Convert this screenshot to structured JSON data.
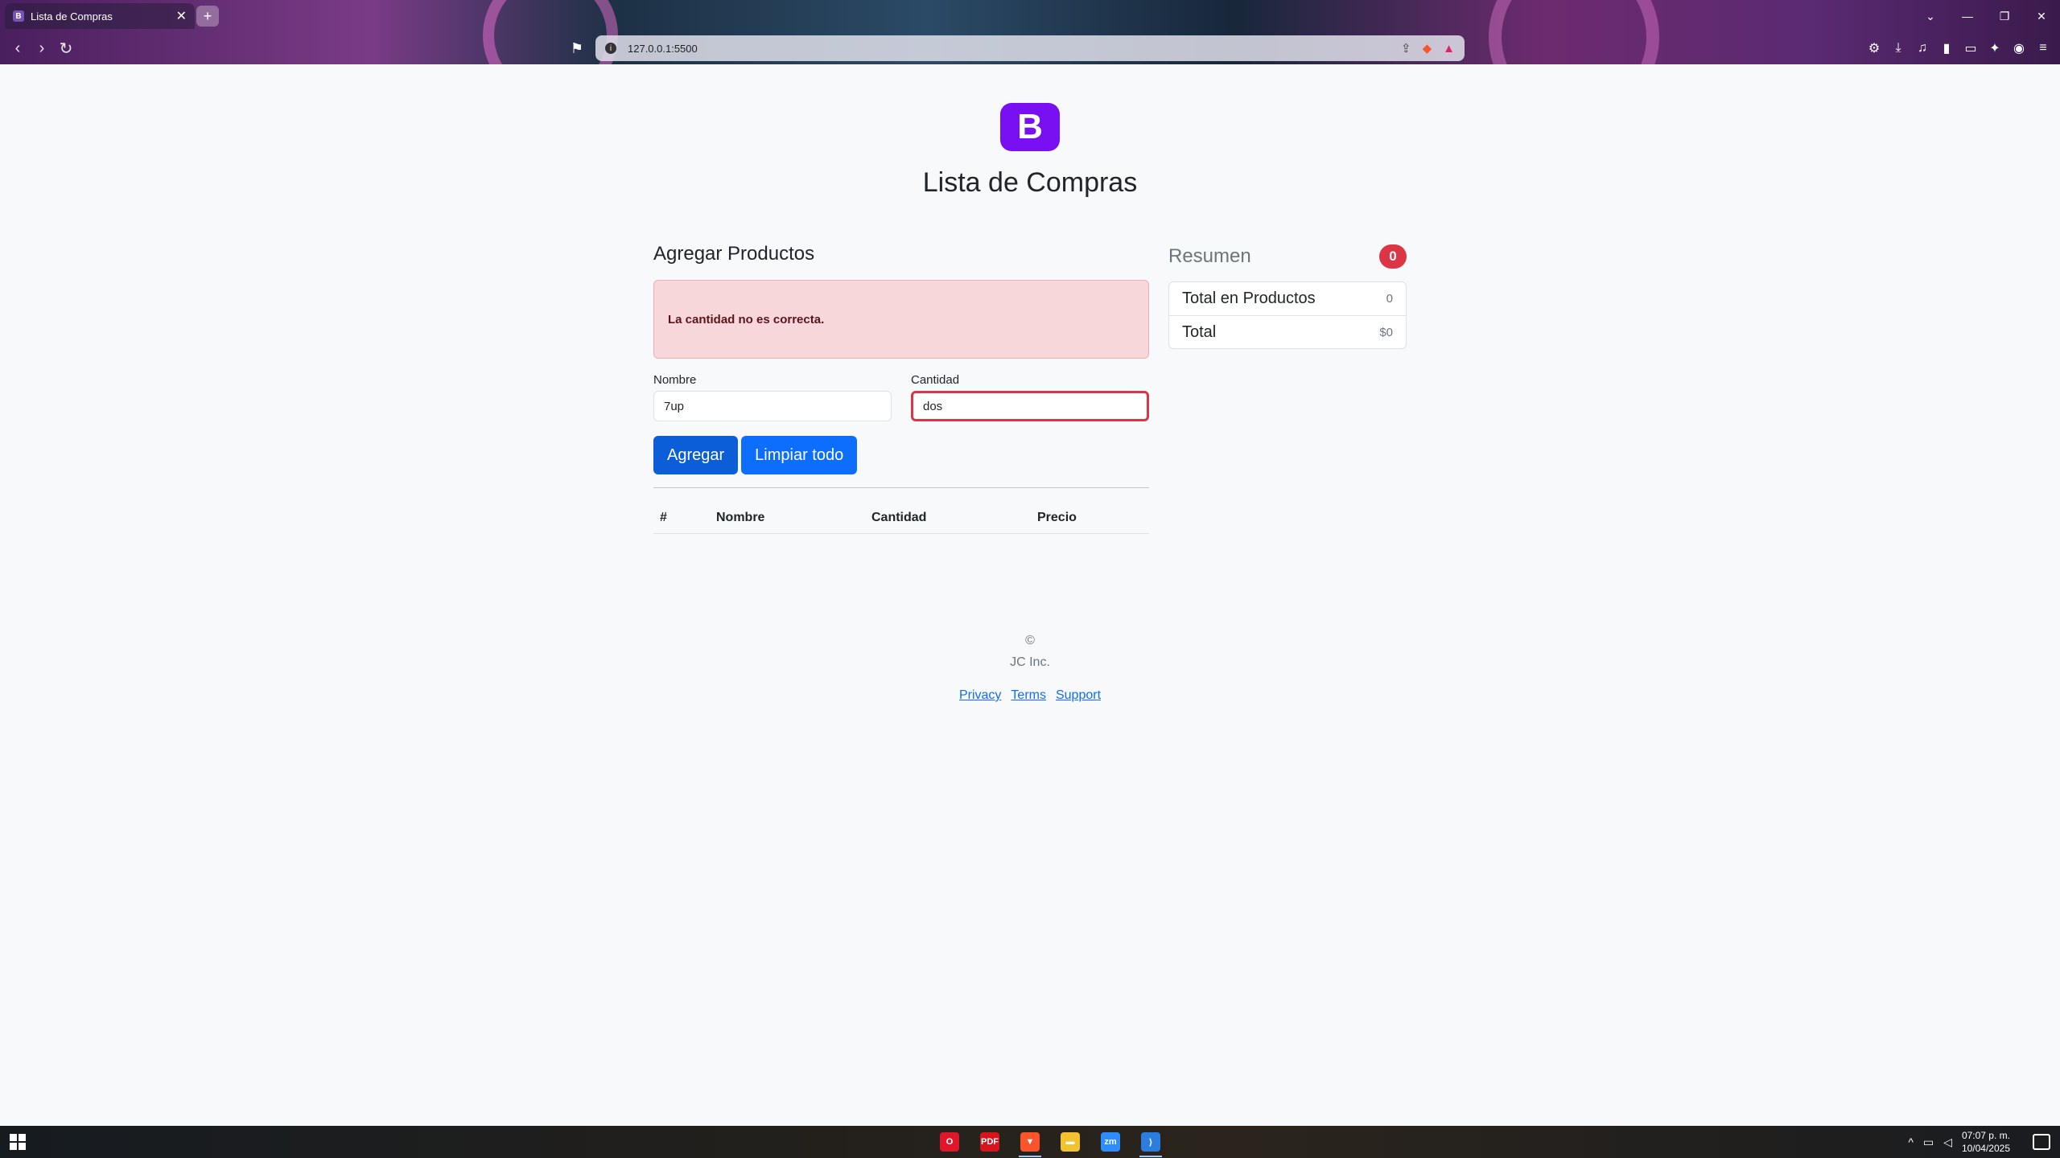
{
  "browser": {
    "tab_title": "Lista de Compras",
    "tab_favicon": "B",
    "tab_close": "✕",
    "new_tab": "+",
    "url": "127.0.0.1:5500",
    "window_controls": [
      "⌄",
      "—",
      "❐",
      "✕"
    ]
  },
  "header": {
    "logo_letter": "B",
    "title": "Lista de Compras"
  },
  "form": {
    "section_title": "Agregar Productos",
    "alert_text": "La cantidad no es correcta.",
    "nombre_label": "Nombre",
    "nombre_value": "7up",
    "cantidad_label": "Cantidad",
    "cantidad_value": "dos",
    "add_button": "Agregar",
    "clear_button": "Limpiar todo"
  },
  "table": {
    "headers": [
      "#",
      "Nombre",
      "Cantidad",
      "Precio"
    ],
    "rows": []
  },
  "summary": {
    "title": "Resumen",
    "badge_count": "0",
    "items": [
      {
        "label": "Total en Productos",
        "value": "0"
      },
      {
        "label": "Total",
        "value": "$0"
      }
    ]
  },
  "footer": {
    "copyright": "©",
    "company": "JC Inc.",
    "links": [
      "Privacy",
      "Terms",
      "Support"
    ]
  },
  "taskbar": {
    "apps": [
      {
        "name": "opera-icon",
        "label": "O",
        "color": "#e0162b"
      },
      {
        "name": "pdf-icon",
        "label": "PDF",
        "color": "#d8141f"
      },
      {
        "name": "brave-icon",
        "label": "▼",
        "color": "#fb542b"
      },
      {
        "name": "file-explorer-icon",
        "label": "▬",
        "color": "#f2c230"
      },
      {
        "name": "zoom-icon",
        "label": "zm",
        "color": "#2d8cff"
      },
      {
        "name": "vscode-icon",
        "label": "⟩",
        "color": "#2b7de0"
      }
    ],
    "clock_time": "07:07 p. m.",
    "clock_date": "10/04/2025"
  },
  "colors": {
    "primary": "#0d6efd",
    "danger": "#dc3545",
    "logo": "#7910f2",
    "alert_bg": "#f8d7da"
  }
}
